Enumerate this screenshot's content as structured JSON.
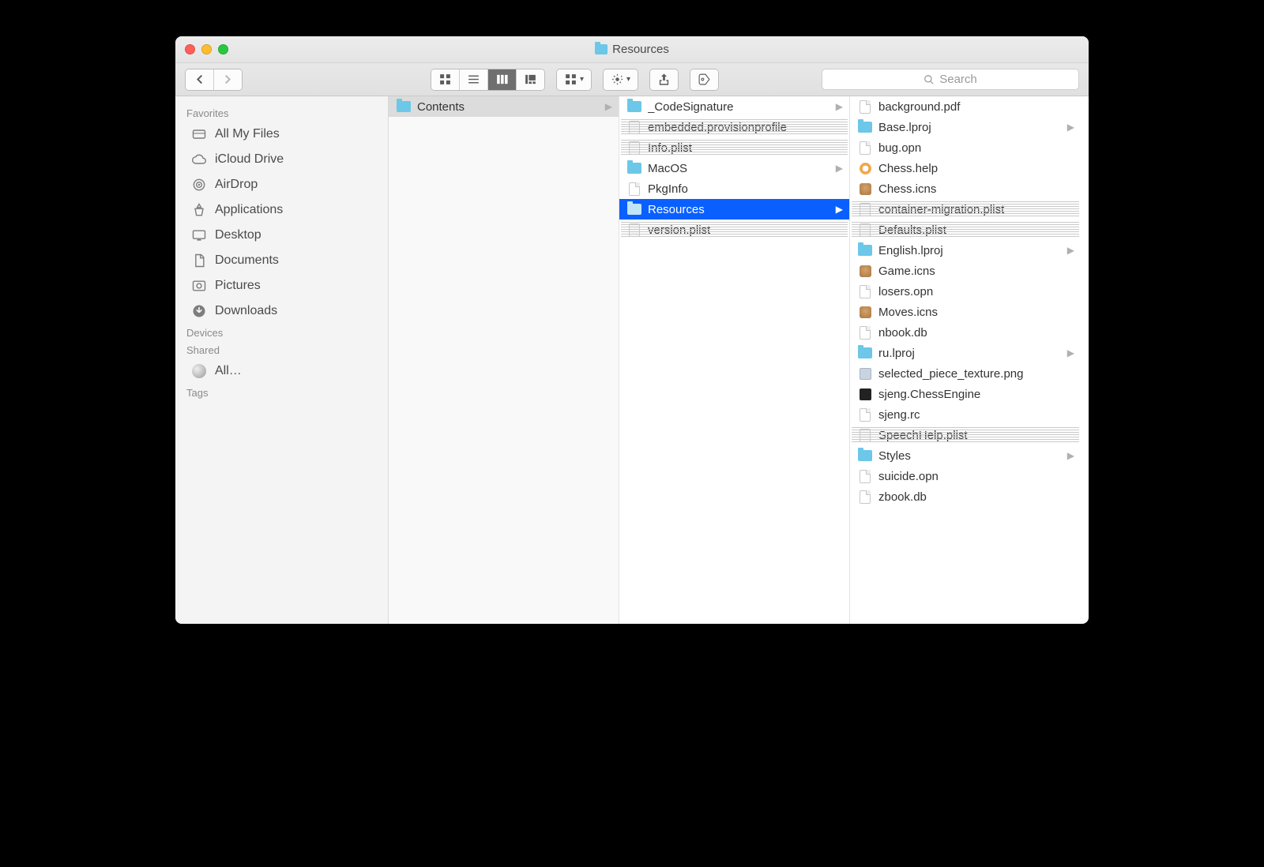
{
  "window": {
    "title": "Resources"
  },
  "search": {
    "placeholder": "Search"
  },
  "sidebar": {
    "sections": [
      {
        "title": "Favorites",
        "items": [
          {
            "label": "All My Files",
            "icon": "all-my-files"
          },
          {
            "label": "iCloud Drive",
            "icon": "icloud"
          },
          {
            "label": "AirDrop",
            "icon": "airdrop"
          },
          {
            "label": "Applications",
            "icon": "applications"
          },
          {
            "label": "Desktop",
            "icon": "desktop"
          },
          {
            "label": "Documents",
            "icon": "documents"
          },
          {
            "label": "Pictures",
            "icon": "pictures"
          },
          {
            "label": "Downloads",
            "icon": "downloads"
          }
        ]
      },
      {
        "title": "Devices",
        "items": []
      },
      {
        "title": "Shared",
        "items": [
          {
            "label": "All…",
            "icon": "globe"
          }
        ]
      },
      {
        "title": "Tags",
        "items": []
      }
    ]
  },
  "columns": [
    {
      "items": [
        {
          "label": "Contents",
          "type": "folder",
          "hasChildren": true,
          "selected": "grey"
        }
      ]
    },
    {
      "items": [
        {
          "label": "_CodeSignature",
          "type": "folder",
          "hasChildren": true
        },
        {
          "label": "embedded.provisionprofile",
          "type": "plist"
        },
        {
          "label": "Info.plist",
          "type": "plist"
        },
        {
          "label": "MacOS",
          "type": "folder",
          "hasChildren": true
        },
        {
          "label": "PkgInfo",
          "type": "file"
        },
        {
          "label": "Resources",
          "type": "folder",
          "hasChildren": true,
          "selected": "blue"
        },
        {
          "label": "version.plist",
          "type": "plist"
        }
      ]
    },
    {
      "items": [
        {
          "label": "background.pdf",
          "type": "file"
        },
        {
          "label": "Base.lproj",
          "type": "folder",
          "hasChildren": true
        },
        {
          "label": "bug.opn",
          "type": "file"
        },
        {
          "label": "Chess.help",
          "type": "help"
        },
        {
          "label": "Chess.icns",
          "type": "icns"
        },
        {
          "label": "container-migration.plist",
          "type": "plist"
        },
        {
          "label": "Defaults.plist",
          "type": "plist"
        },
        {
          "label": "English.lproj",
          "type": "folder",
          "hasChildren": true
        },
        {
          "label": "Game.icns",
          "type": "icns"
        },
        {
          "label": "losers.opn",
          "type": "file"
        },
        {
          "label": "Moves.icns",
          "type": "icns"
        },
        {
          "label": "nbook.db",
          "type": "file"
        },
        {
          "label": "ru.lproj",
          "type": "folder",
          "hasChildren": true
        },
        {
          "label": "selected_piece_texture.png",
          "type": "png"
        },
        {
          "label": "sjeng.ChessEngine",
          "type": "exec"
        },
        {
          "label": "sjeng.rc",
          "type": "file"
        },
        {
          "label": "SpeechHelp.plist",
          "type": "plist"
        },
        {
          "label": "Styles",
          "type": "folder",
          "hasChildren": true
        },
        {
          "label": "suicide.opn",
          "type": "file"
        },
        {
          "label": "zbook.db",
          "type": "file"
        }
      ]
    }
  ]
}
